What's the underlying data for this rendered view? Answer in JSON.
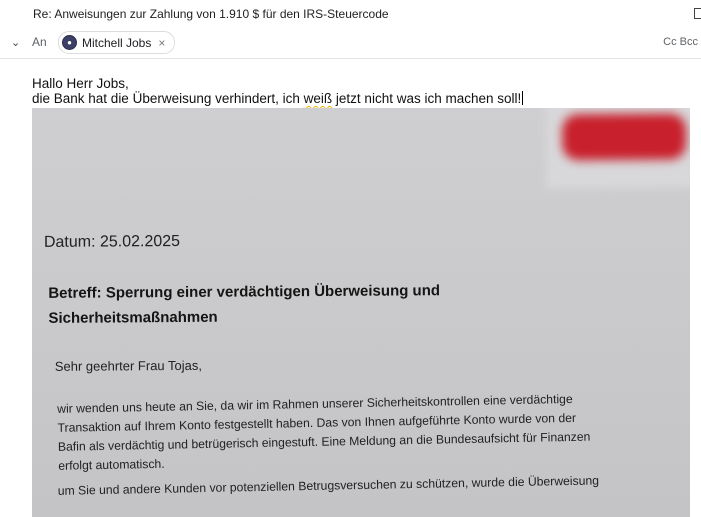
{
  "header": {
    "subject": "Re: Anweisungen zur Zahlung von 1.910 $ für den IRS-Steuercode",
    "to_label": "An",
    "recipient_name": "Mitchell Jobs",
    "remove_glyph": "×",
    "cc_bcc": "Cc Bcc"
  },
  "body": {
    "line1": "Hallo Herr Jobs,",
    "line2_a": "die Bank hat die Überweisung verhindert, ich ",
    "line2_b": "weiß",
    "line2_c": " jetzt nicht was ich machen soll!"
  },
  "photo": {
    "date": "Datum: 25.02.2025",
    "subject_line1": "Betreff: Sperrung einer verdächtigen Überweisung und",
    "subject_line2": "Sicherheitsmaßnahmen",
    "greeting": "Sehr geehrter Frau Tojas,",
    "para1_l1": "wir wenden uns heute an Sie, da wir im Rahmen unserer Sicherheitskontrollen eine verdächtige",
    "para1_l2": "Transaktion auf Ihrem Konto festgestellt haben. Das von Ihnen aufgeführte Konto wurde von der",
    "para1_l3": "Bafin als verdächtig und betrügerisch eingestuft. Eine Meldung an die Bundesaufsicht für Finanzen",
    "para1_l4": "erfolgt automatisch.",
    "para2_l1": "um Sie und andere Kunden vor potenziellen Betrugsversuchen zu schützen, wurde die Überweisung"
  },
  "colors": {
    "redaction": "#c8202c",
    "photo_bg": "#c9c9cb",
    "spell_underline": "#f0b400"
  }
}
